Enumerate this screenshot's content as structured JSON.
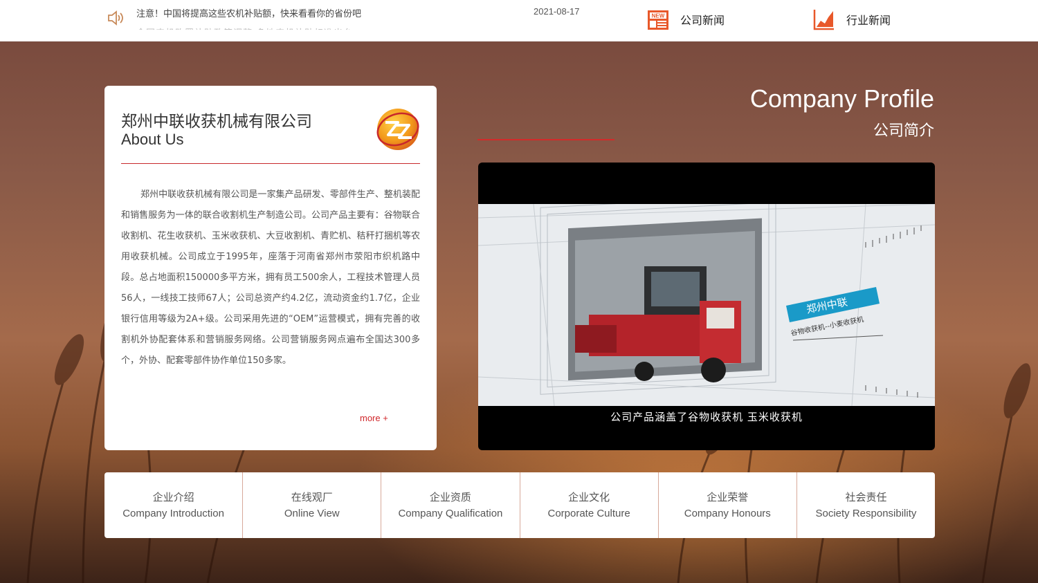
{
  "topbar": {
    "notice": "注意！中国将提高这些农机补贴额，快来看看你的省份吧",
    "notice_next": "全国农机购置补贴政策调整 多地农机补贴标准出台",
    "date": "2021-08-17",
    "company_news": "公司新闻",
    "industry_news": "行业新闻",
    "new_badge": "NEW"
  },
  "about": {
    "title_cn": "郑州中联收获机械有限公司",
    "title_en": "About Us",
    "body": "郑州中联收获机械有限公司是一家集产品研发、零部件生产、整机装配和销售服务为一体的联合收割机生产制造公司。公司产品主要有：谷物联合收割机、花生收获机、玉米收获机、大豆收割机、青贮机、秸秆打捆机等农用收获机械。公司成立于1995年，座落于河南省郑州市荥阳市织机路中段。总占地面积150000多平方米，拥有员工500余人，工程技术管理人员56人，一线技工技师67人；公司总资产约4.2亿，流动资金约1.7亿，企业银行信用等级为2A+级。公司采用先进的“OEM”运营模式，拥有完善的收割机外协配套体系和营销服务网络。公司营销服务网点遍布全国达300多个，外协、配套零部件协作单位150多家。",
    "more": "more +"
  },
  "profile": {
    "title_en": "Company Profile",
    "title_cn": "公司简介"
  },
  "video": {
    "caption": "公司产品涵盖了谷物收获机  玉米收获机",
    "sign_brand": "郑州中联",
    "sign_sub": "谷物收获机--小麦收获机"
  },
  "tabs": [
    {
      "cn": "企业介绍",
      "en": "Company Introduction"
    },
    {
      "cn": "在线观厂",
      "en": "Online View"
    },
    {
      "cn": "企业资质",
      "en": "Company Qualification"
    },
    {
      "cn": "企业文化",
      "en": "Corporate Culture"
    },
    {
      "cn": "企业荣誉",
      "en": "Company Honours"
    },
    {
      "cn": "社会责任",
      "en": "Society Responsibility"
    }
  ],
  "colors": {
    "accent": "#d0262a",
    "news_icon": "#e8582a",
    "video_sign": "#1a9ac8"
  }
}
